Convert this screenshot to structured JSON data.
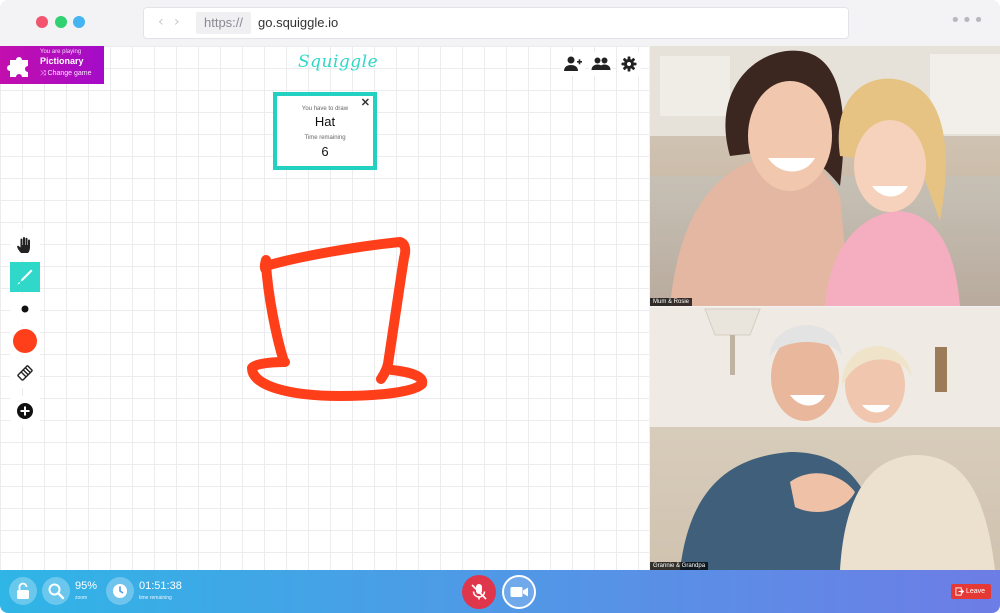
{
  "browser": {
    "scheme": "https://",
    "url": "go.squiggle.io",
    "traffic_colors": [
      "#f2546e",
      "#2fd170",
      "#45b4f2"
    ]
  },
  "game": {
    "playing_label": "You are playing",
    "name": "Pictionary",
    "change_label": "⤨ Change game",
    "logo": "Squiggle"
  },
  "prompt": {
    "draw_label": "You have to draw",
    "word": "Hat",
    "time_label": "Time remaining",
    "time_value": "6",
    "close": "✕"
  },
  "toolbar": {
    "icons": [
      "add-user-icon",
      "users-icon",
      "gear-icon"
    ]
  },
  "tools": [
    {
      "name": "hand-tool",
      "icon": "hand-icon"
    },
    {
      "name": "pen-tool",
      "icon": "pen-icon",
      "active": true
    },
    {
      "name": "brush-size",
      "icon": "dot-icon"
    },
    {
      "name": "color-picker",
      "icon": "color-swatch",
      "color": "#ff3e1a"
    },
    {
      "name": "eraser-tool",
      "icon": "eraser-icon"
    },
    {
      "name": "add-tool",
      "icon": "plus-icon"
    }
  ],
  "drawing": {
    "stroke_color": "#ff3e1a"
  },
  "videos": [
    {
      "label": "Mum & Rosie"
    },
    {
      "label": "Grannie & Grandpa"
    }
  ],
  "bottom_bar": {
    "zoom_value": "95%",
    "zoom_label": "zoom",
    "time_value": "01:51:38",
    "time_label": "time remaining",
    "leave_label": "Leave"
  }
}
